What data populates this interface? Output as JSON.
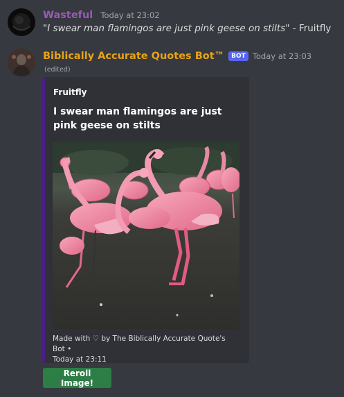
{
  "messages": [
    {
      "username": "Wasteful",
      "username_color": "#9b59b6",
      "timestamp": "Today at 23:02",
      "quote": "\"I swear man flamingos are just pink geese on stilts\"",
      "attribution": " - Fruitfly"
    },
    {
      "username": "Biblically Accurate Quotes Bot™",
      "username_color": "#e8a317",
      "bot_tag": "BOT",
      "timestamp": "Today at 23:03",
      "edited": "(edited)",
      "embed": {
        "accent_color": "#4c1d8a",
        "author": "Fruitfly",
        "title": "I swear man flamingos are just pink geese on stilts",
        "footer_line1": "Made with ♡ by The Biblically Accurate Quote's Bot •",
        "footer_line2": "Today at 23:11"
      },
      "button": {
        "label": "Reroll Image!",
        "color": "#2d7d46"
      }
    }
  ]
}
